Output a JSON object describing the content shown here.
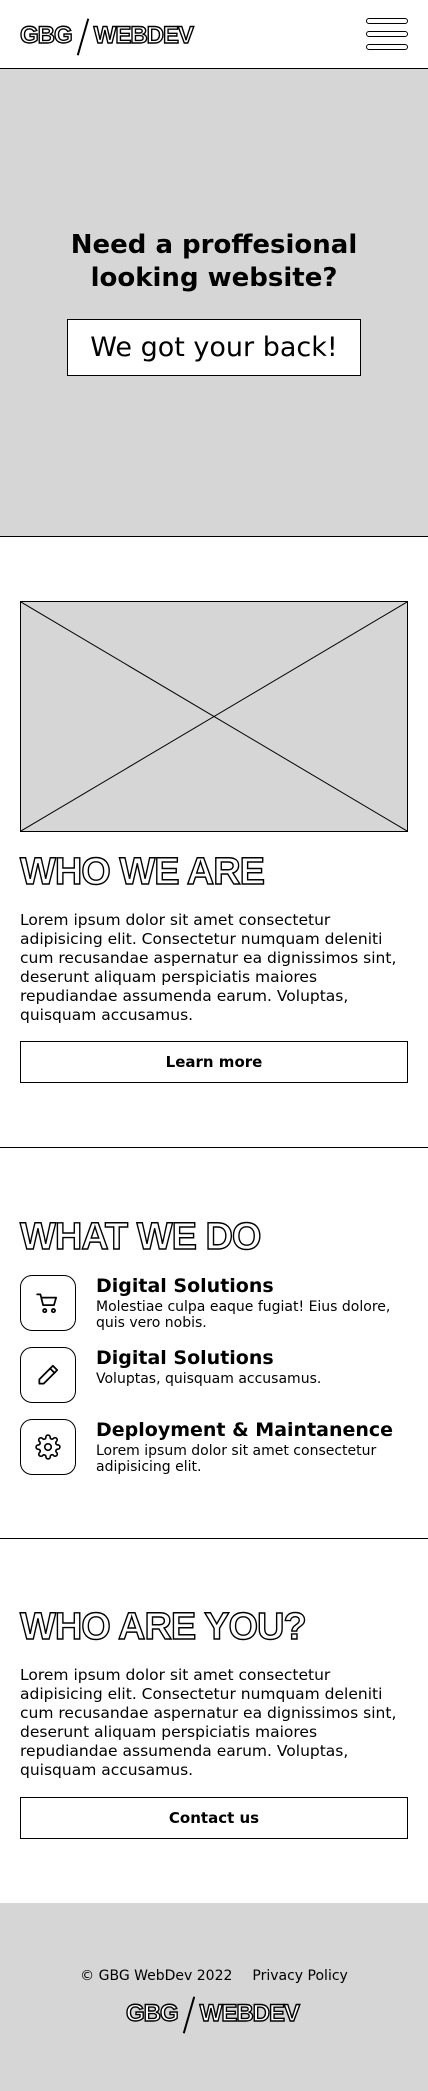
{
  "header": {
    "logo_left": "GBG",
    "logo_right": "WEBDEV"
  },
  "hero": {
    "headline": "Need a proffesional looking website?",
    "cta_label": "We got your back!"
  },
  "about": {
    "title": "WHO WE ARE",
    "text": "Lorem ipsum dolor sit amet consectetur adipisicing elit. Consectetur numquam deleniti cum recusandae aspernatur ea dignissimos sint, deserunt aliquam perspiciatis maiores repudiandae assumenda earum. Voluptas, quisquam accusamus.",
    "button_label": "Learn more"
  },
  "services": {
    "title": "WHAT WE DO",
    "items": [
      {
        "icon": "cart-icon",
        "title": "Digital Solutions",
        "text": "Molestiae culpa eaque fugiat! Eius dolore, quis vero nobis."
      },
      {
        "icon": "pencil-icon",
        "title": "Digital Solutions",
        "text": "Voluptas, quisquam accusamus."
      },
      {
        "icon": "gear-icon",
        "title": "Deployment & Maintanence",
        "text": "Lorem ipsum dolor sit amet consectetur adipisicing elit."
      }
    ]
  },
  "audience": {
    "title": "WHO ARE YOU?",
    "text": "Lorem ipsum dolor sit amet consectetur adipisicing elit. Consectetur numquam deleniti cum recusandae aspernatur ea dignissimos sint, deserunt aliquam perspiciatis maiores repudiandae assumenda earum. Voluptas, quisquam accusamus.",
    "button_label": "Contact us"
  },
  "footer": {
    "copyright": "© GBG WebDev 2022",
    "privacy_label": "Privacy Policy",
    "logo_left": "GBG",
    "logo_right": "WEBDEV"
  },
  "colors": {
    "placeholder_gray": "#d6d6d6",
    "ink": "#000000",
    "background": "#ffffff"
  }
}
